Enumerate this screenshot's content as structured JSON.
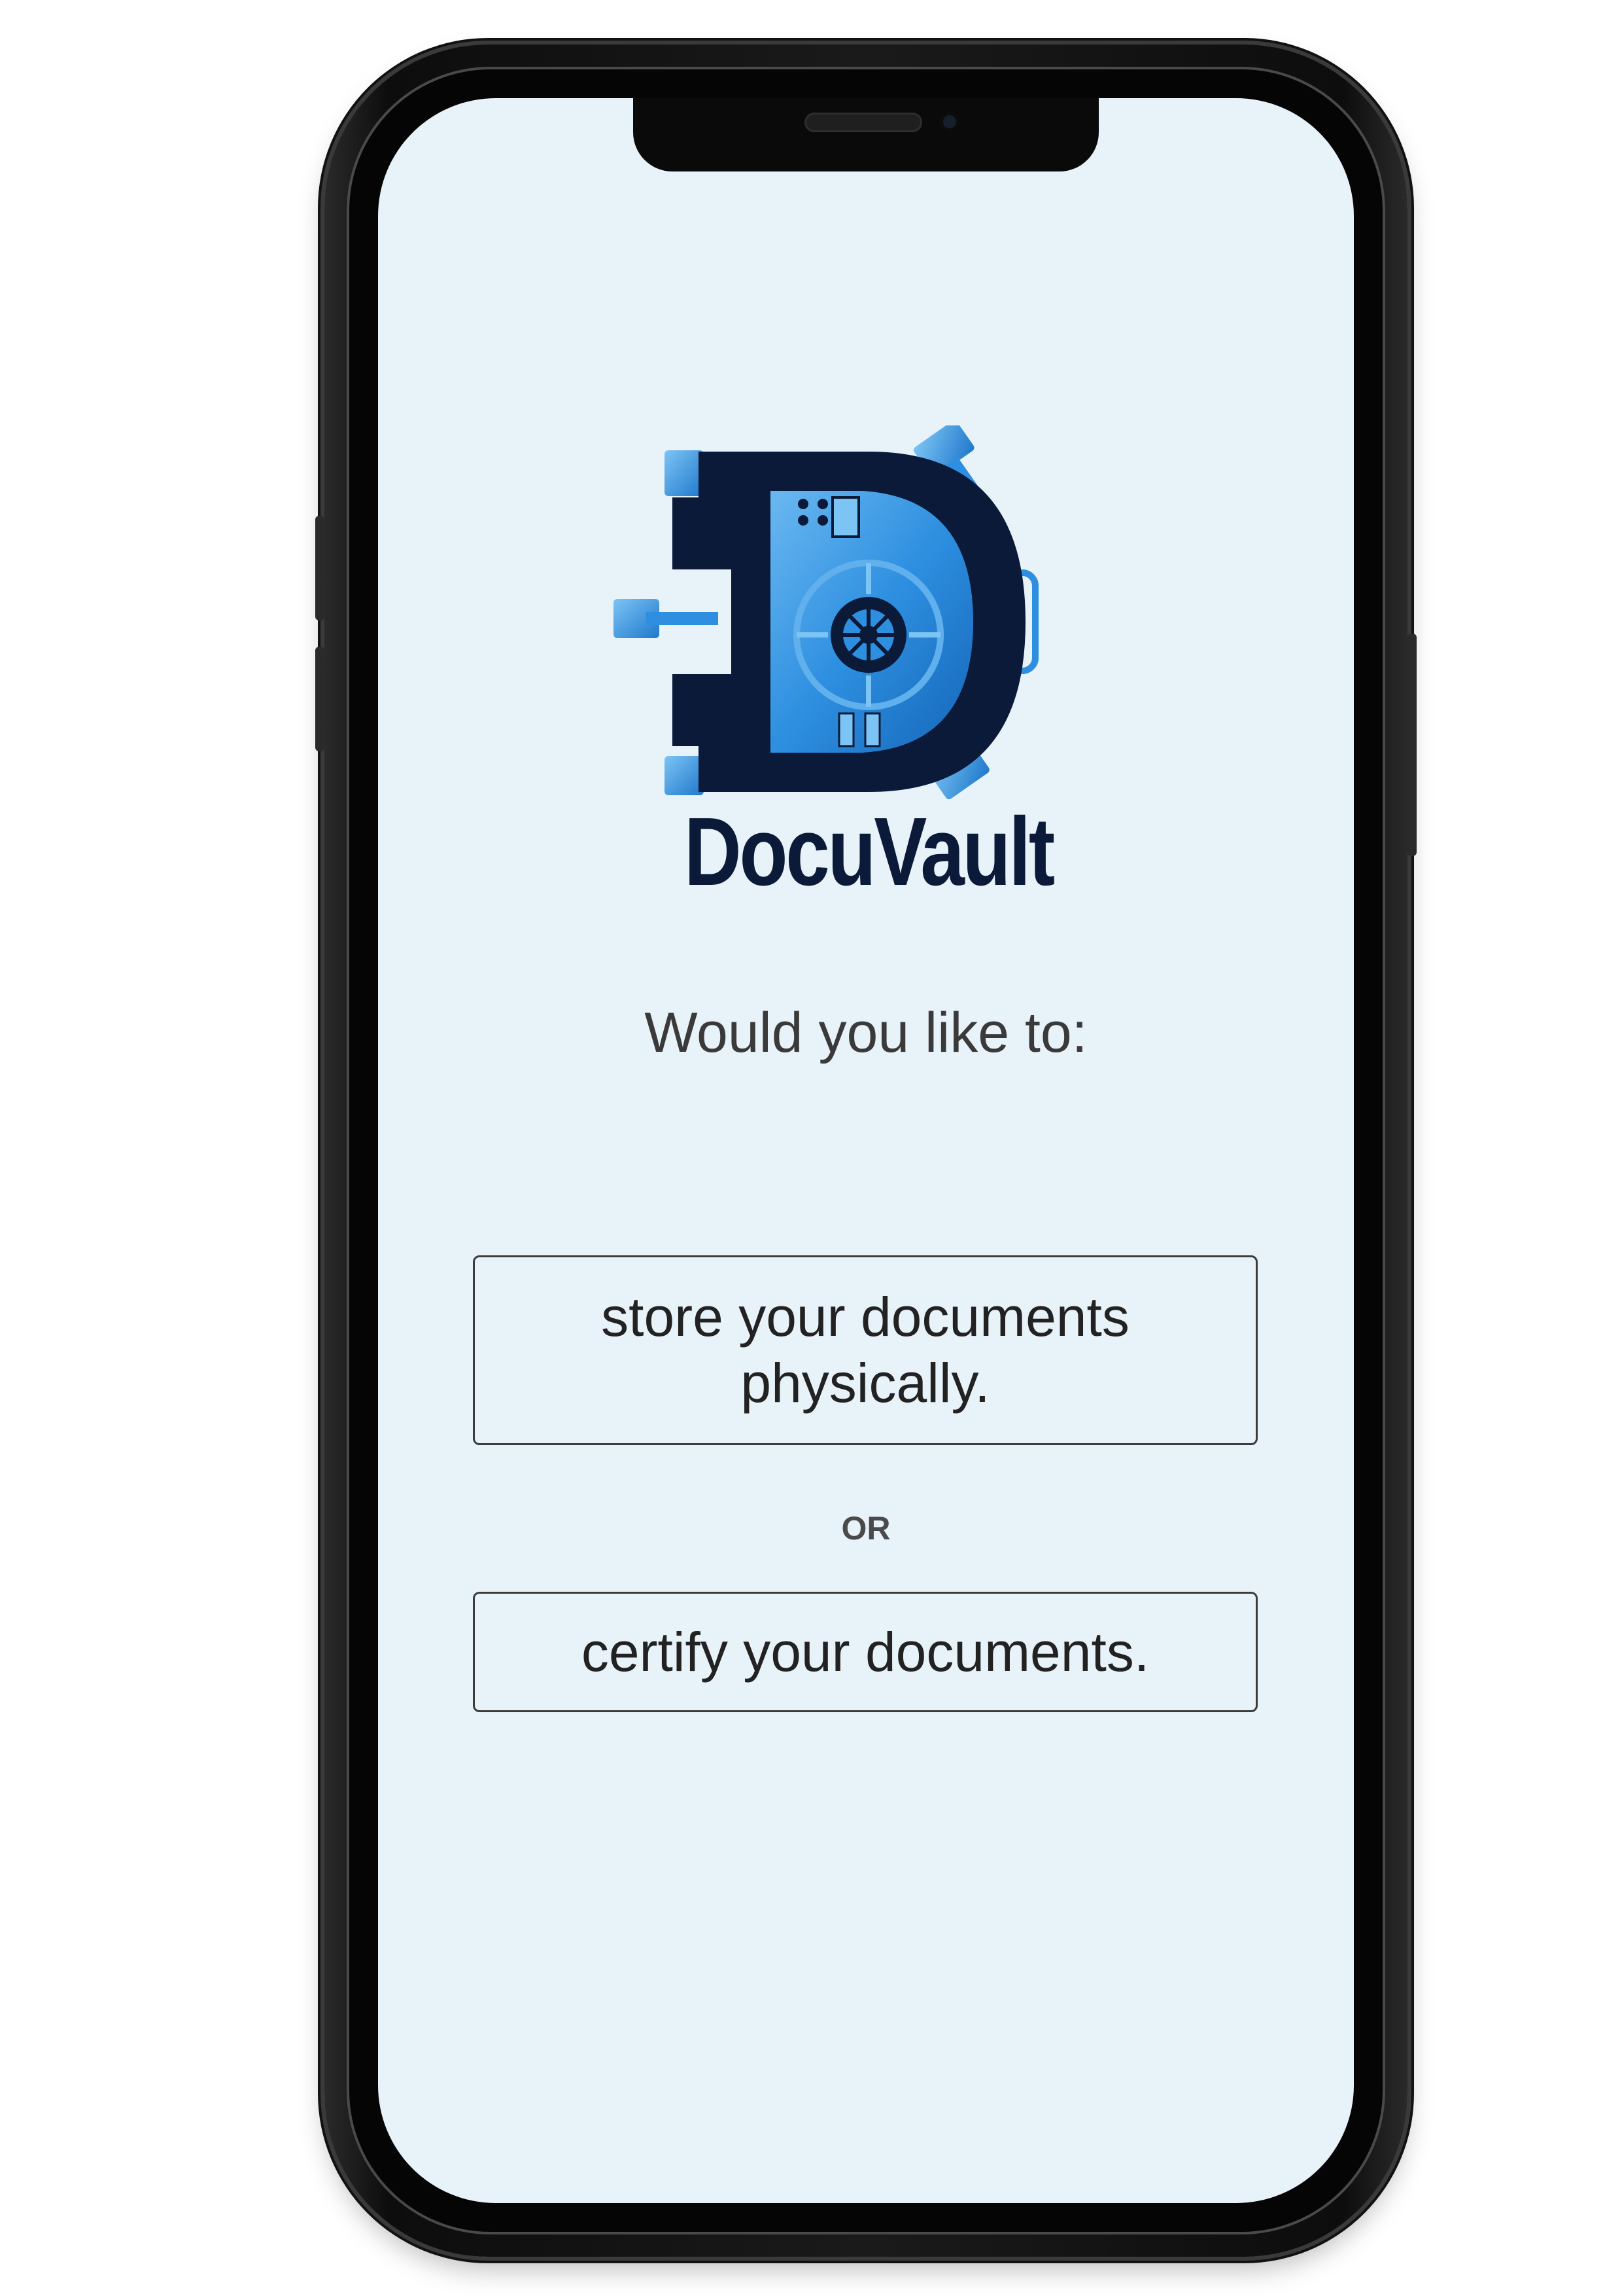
{
  "app": {
    "brand_name": "DocuVault",
    "logo_icon": "vault-door-d-logo"
  },
  "screen": {
    "prompt": "Would you like to:",
    "options": [
      {
        "label": "store your documents physically."
      },
      {
        "label": "certify your documents."
      }
    ],
    "separator": "OR"
  },
  "colors": {
    "screen_background": "#e8f2f9",
    "brand_navy": "#0b1a38",
    "logo_blue": "#2e8fe0",
    "text_dark": "#222222",
    "button_border": "#3c3c3c"
  }
}
